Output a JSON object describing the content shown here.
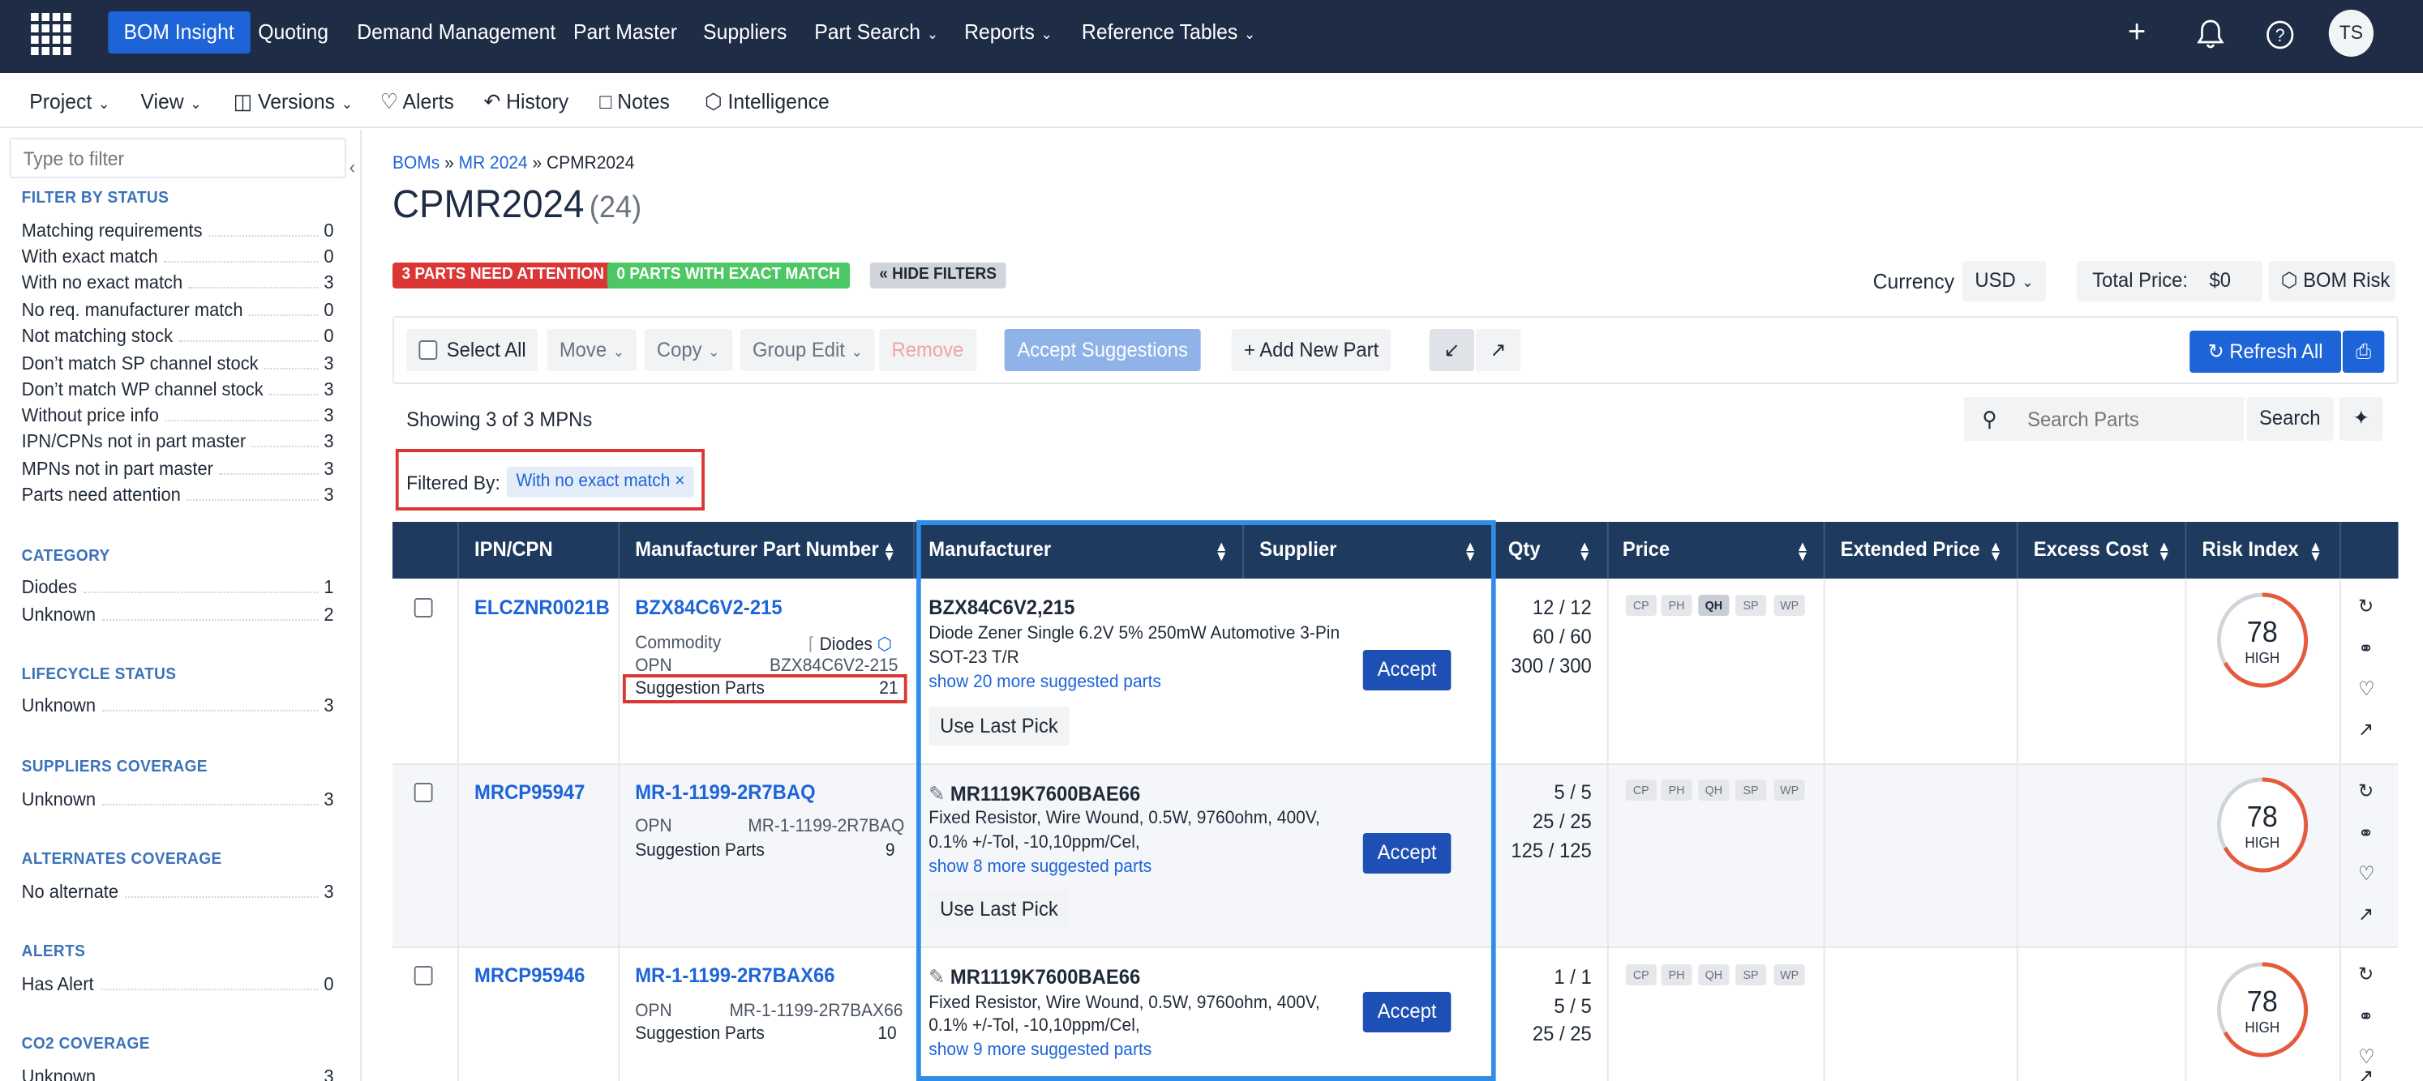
{
  "app": {
    "logo": "app-grid-icon",
    "avatar": "TS"
  },
  "nav": {
    "bom_insight": "BOM Insight",
    "quoting": "Quoting",
    "demand": "Demand Management",
    "part_master": "Part Master",
    "suppliers": "Suppliers",
    "part_search": "Part Search",
    "reports": "Reports",
    "reference": "Reference Tables"
  },
  "subnav": {
    "project": "Project",
    "view": "View",
    "versions": "Versions",
    "alerts": "Alerts",
    "history": "History",
    "notes": "Notes",
    "intelligence": "Intelligence"
  },
  "sidebar": {
    "filter_placeholder": "Type to filter",
    "status_title": "FILTER BY STATUS",
    "status": [
      {
        "label": "Matching requirements",
        "count": "0"
      },
      {
        "label": "With exact match",
        "count": "0"
      },
      {
        "label": "With no exact match",
        "count": "3"
      },
      {
        "label": "No req. manufacturer match",
        "count": "0"
      },
      {
        "label": "Not matching stock",
        "count": "0"
      },
      {
        "label": "Don’t match SP channel stock",
        "count": "3"
      },
      {
        "label": "Don’t match WP channel stock",
        "count": "3"
      },
      {
        "label": "Without price info",
        "count": "3"
      },
      {
        "label": "IPN/CPNs not in part master",
        "count": "3"
      },
      {
        "label": "MPNs not in part master",
        "count": "3"
      },
      {
        "label": "Parts need attention",
        "count": "3"
      }
    ],
    "category_title": "CATEGORY",
    "category": [
      {
        "label": "Diodes",
        "count": "1"
      },
      {
        "label": "Unknown",
        "count": "2"
      }
    ],
    "lifecycle_title": "LIFECYCLE STATUS",
    "lifecycle": [
      {
        "label": "Unknown",
        "count": "3"
      }
    ],
    "suppliers_title": "SUPPLIERS COVERAGE",
    "suppliers": [
      {
        "label": "Unknown",
        "count": "3"
      }
    ],
    "alternates_title": "ALTERNATES COVERAGE",
    "alternates": [
      {
        "label": "No alternate",
        "count": "3"
      }
    ],
    "alerts_title": "ALERTS",
    "alerts": [
      {
        "label": "Has Alert",
        "count": "0"
      }
    ],
    "co2_title": "CO2 COVERAGE",
    "co2": [
      {
        "label": "Unknown",
        "count": "3"
      }
    ]
  },
  "breadcrumb": {
    "boms": "BOMs",
    "sep": "»",
    "mr": "MR 2024",
    "current": "CPMR2024"
  },
  "title": {
    "name": "CPMR2024",
    "count": "(24)"
  },
  "badges": {
    "attention": "3 PARTS NEED ATTENTION",
    "exact": "0 PARTS WITH EXACT MATCH",
    "hide": "« HIDE FILTERS"
  },
  "currency": {
    "label": "Currency",
    "value": "USD"
  },
  "total": {
    "label": "Total Price:",
    "value": "$0"
  },
  "bom_risk": "BOM Risk",
  "toolbar": {
    "select_all": "Select All",
    "move": "Move",
    "copy": "Copy",
    "group_edit": "Group Edit",
    "remove": "Remove",
    "accept_suggestions": "Accept Suggestions",
    "add_new_part": "Add New Part",
    "refresh_all": "Refresh All"
  },
  "showing": "Showing 3 of 3 MPNs",
  "search": {
    "placeholder": "Search Parts",
    "button": "Search"
  },
  "filtered_by": {
    "label": "Filtered By:",
    "chip": "With no exact match"
  },
  "columns": {
    "ipn": "IPN/CPN",
    "mpn": "Manufacturer Part Number",
    "manufacturer": "Manufacturer",
    "supplier": "Supplier",
    "qty": "Qty",
    "price": "Price",
    "extended": "Extended Price",
    "excess": "Excess Cost",
    "risk": "Risk Index"
  },
  "price_tags": [
    "CP",
    "PH",
    "QH",
    "SP",
    "WP"
  ],
  "rows": [
    {
      "ipn": "ELCZNR0021B",
      "mpn": "BZX84C6V2-215",
      "commodity_label": "Commodity",
      "commodity": "Diodes",
      "opn_label": "OPN",
      "opn": "BZX84C6V2-215",
      "sugg_label": "Suggestion Parts",
      "sugg": "21",
      "part": "BZX84C6V2,215",
      "desc1": "Diode Zener Single 6.2V 5% 250mW Automotive 3-Pin",
      "desc2": "SOT-23 T/R",
      "more": "show 20 more suggested parts",
      "accept": "Accept",
      "last_pick": "Use Last Pick",
      "qty": [
        "12 / 12",
        "60 / 60",
        "300 / 300"
      ],
      "risk": "78",
      "risk_level": "HIGH"
    },
    {
      "ipn": "MRCP95947",
      "mpn": "MR-1-1199-2R7BAQ",
      "opn_label": "OPN",
      "opn": "MR-1-1199-2R7BAQ",
      "sugg_label": "Suggestion Parts",
      "sugg": "9",
      "part": "MR1119K7600BAE66",
      "desc1": "Fixed Resistor, Wire Wound, 0.5W, 9760ohm, 400V,",
      "desc2": "0.1% +/-Tol, -10,10ppm/Cel,",
      "more": "show 8 more suggested parts",
      "accept": "Accept",
      "last_pick": "Use Last Pick",
      "qty": [
        "5 / 5",
        "25 / 25",
        "125 / 125"
      ],
      "risk": "78",
      "risk_level": "HIGH"
    },
    {
      "ipn": "MRCP95946",
      "mpn": "MR-1-1199-2R7BAX66",
      "opn_label": "OPN",
      "opn": "MR-1-1199-2R7BAX66",
      "sugg_label": "Suggestion Parts",
      "sugg": "10",
      "part": "MR1119K7600BAE66",
      "desc1": "Fixed Resistor, Wire Wound, 0.5W, 9760ohm, 400V,",
      "desc2": "0.1% +/-Tol, -10,10ppm/Cel,",
      "more": "show 9 more suggested parts",
      "accept": "Accept",
      "qty": [
        "1 / 1",
        "5 / 5",
        "25 / 25"
      ],
      "risk": "78",
      "risk_level": "HIGH"
    }
  ],
  "colors": {
    "nav_bg": "#1e2d45",
    "accent": "#1d64d9",
    "header_bg": "#1e3a5f",
    "danger": "#dc3535",
    "success": "#4cc763",
    "highlight": "#2f8fe8",
    "gauge_ring": "#e65a3c"
  }
}
